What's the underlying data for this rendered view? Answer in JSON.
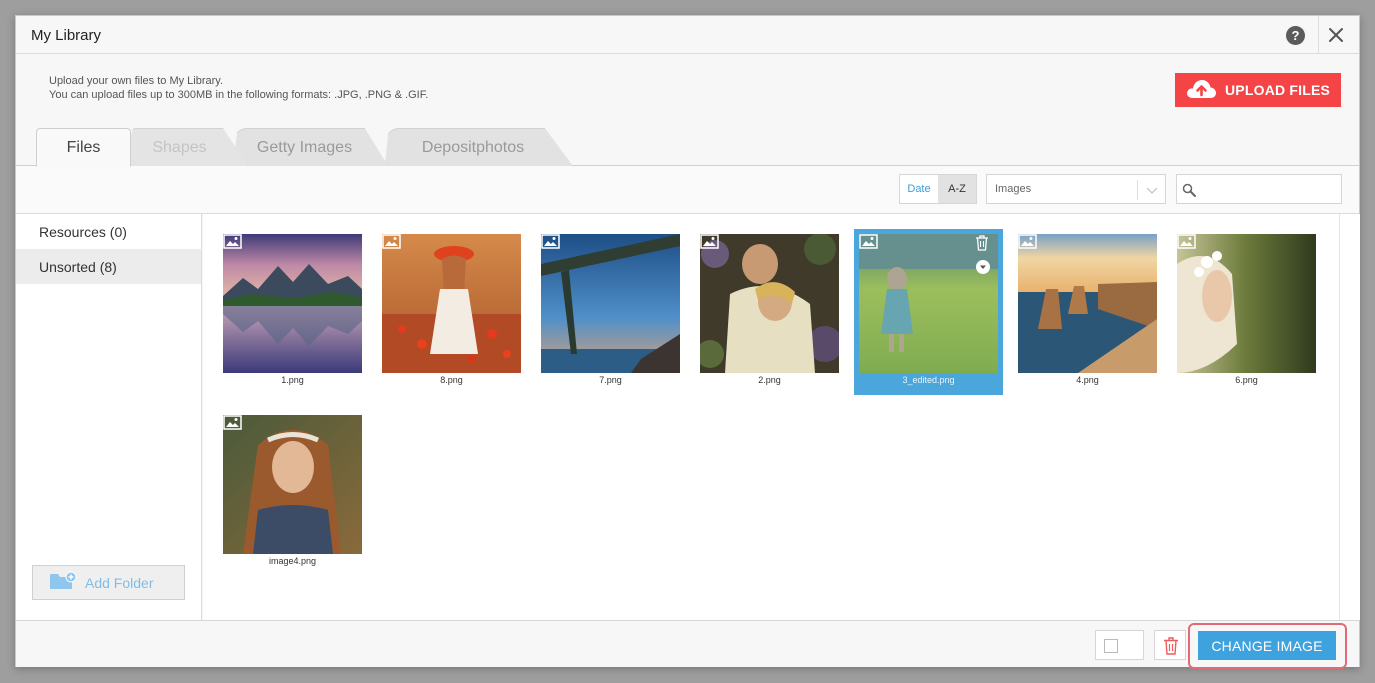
{
  "dialog": {
    "title": "My Library",
    "help_label": "?"
  },
  "info": {
    "line1": "Upload your own files to My Library.",
    "line2": "You can upload files up to 300MB in the following formats: .JPG, .PNG & .GIF."
  },
  "upload": {
    "label": "UPLOAD FILES",
    "color": "#f44446"
  },
  "tabs": [
    {
      "label": "Files"
    },
    {
      "label": "Shapes"
    },
    {
      "label": "Getty Images"
    },
    {
      "label": "Depositphotos"
    }
  ],
  "toolbar": {
    "sort_date": "Date",
    "sort_az": "A-Z",
    "type_filter": "Images",
    "search_placeholder": ""
  },
  "sidebar": {
    "items": [
      {
        "label": "Resources (0)"
      },
      {
        "label": "Unsorted (8)"
      }
    ],
    "add_folder": "Add Folder"
  },
  "files": [
    {
      "name": "1.png",
      "selected": false
    },
    {
      "name": "8.png",
      "selected": false
    },
    {
      "name": "7.png",
      "selected": false
    },
    {
      "name": "2.png",
      "selected": false
    },
    {
      "name": "3_edited.png",
      "selected": true
    },
    {
      "name": "4.png",
      "selected": false
    },
    {
      "name": "6.png",
      "selected": false
    },
    {
      "name": "image4.png",
      "selected": false
    }
  ],
  "footer": {
    "change_image": "CHANGE IMAGE"
  },
  "colors": {
    "accent": "#3da2dd",
    "selection": "#4ba6dc",
    "highlight": "#e06a75"
  }
}
